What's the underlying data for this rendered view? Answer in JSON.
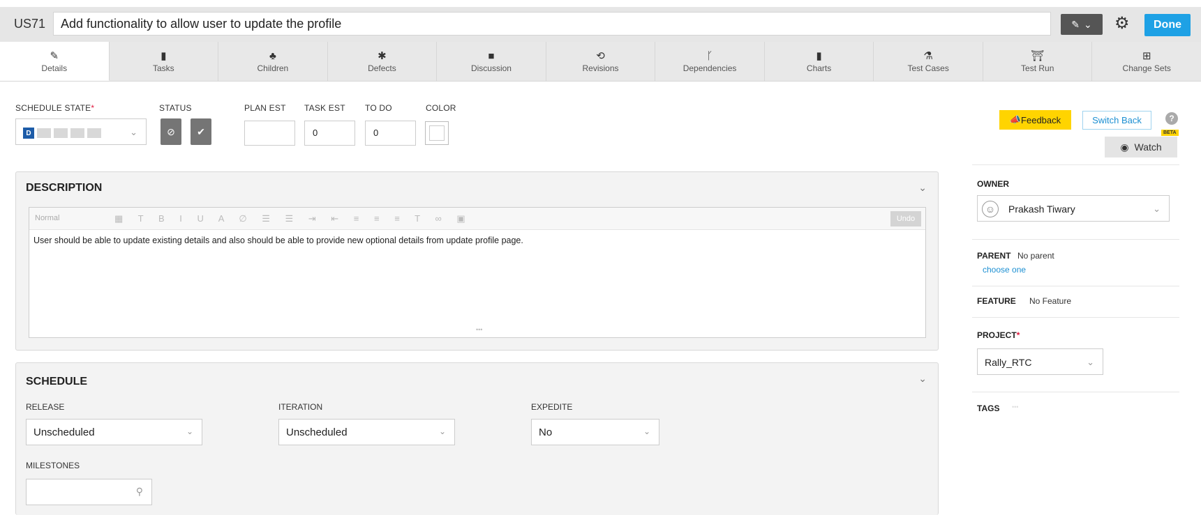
{
  "header": {
    "item_id": "US71",
    "title": "Add functionality to allow user to update the profile",
    "done_label": "Done"
  },
  "tabs": [
    {
      "label": "Details",
      "icon": "pencil-icon",
      "glyph": "✎"
    },
    {
      "label": "Tasks",
      "icon": "clipboard-icon",
      "glyph": "▮"
    },
    {
      "label": "Children",
      "icon": "hierarchy-icon",
      "glyph": "♣"
    },
    {
      "label": "Defects",
      "icon": "bug-icon",
      "glyph": "✱"
    },
    {
      "label": "Discussion",
      "icon": "comment-icon",
      "glyph": "■"
    },
    {
      "label": "Revisions",
      "icon": "history-icon",
      "glyph": "⟲"
    },
    {
      "label": "Dependencies",
      "icon": "branch-icon",
      "glyph": "ᚴ"
    },
    {
      "label": "Charts",
      "icon": "bar-chart-icon",
      "glyph": "▮"
    },
    {
      "label": "Test Cases",
      "icon": "flask-icon",
      "glyph": "⚗"
    },
    {
      "label": "Test Run",
      "icon": "testrun-icon",
      "glyph": "⛩"
    },
    {
      "label": "Change Sets",
      "icon": "changeset-icon",
      "glyph": "⊞"
    }
  ],
  "fields": {
    "schedule_state_label": "SCHEDULE STATE",
    "schedule_state_value": "D",
    "status_label": "STATUS",
    "plan_est_label": "PLAN EST",
    "plan_est_value": "",
    "task_est_label": "TASK EST",
    "task_est_value": "0",
    "todo_label": "TO DO",
    "todo_value": "0",
    "color_label": "COLOR"
  },
  "actions": {
    "feedback": "Feedback",
    "switch_back": "Switch Back",
    "watch": "Watch",
    "beta": "BETA",
    "help": "?"
  },
  "description": {
    "title": "DESCRIPTION",
    "format_placeholder": "Normal",
    "undo": "Undo",
    "text": "User should be able to update existing details and also should be able to provide new optional details from update profile page."
  },
  "schedule": {
    "title": "SCHEDULE",
    "release_label": "RELEASE",
    "release_value": "Unscheduled",
    "iteration_label": "ITERATION",
    "iteration_value": "Unscheduled",
    "expedite_label": "EXPEDITE",
    "expedite_value": "No",
    "milestones_label": "MILESTONES"
  },
  "sidebar": {
    "owner_label": "OWNER",
    "owner_value": "Prakash Tiwary",
    "parent_label": "PARENT",
    "parent_value": "No parent",
    "parent_link": "choose one",
    "feature_label": "FEATURE",
    "feature_value": "No Feature",
    "project_label": "PROJECT",
    "project_value": "Rally_RTC",
    "tags_label": "TAGS"
  },
  "colors": {
    "accent": "#1ea1e5",
    "feedback": "#ffd400",
    "state_badge": "#1d5ca8",
    "required": "#e0183d"
  }
}
